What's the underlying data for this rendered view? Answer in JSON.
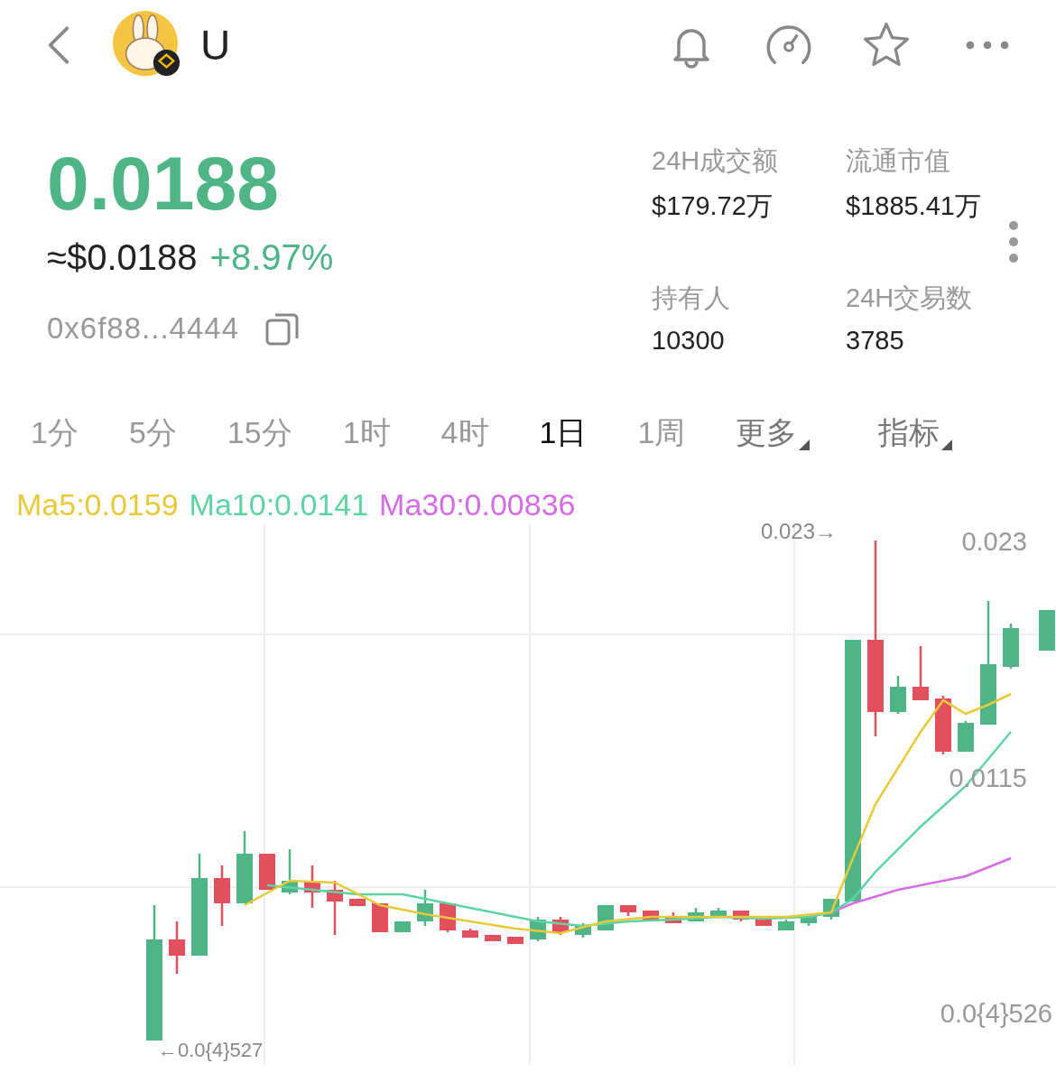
{
  "header": {
    "token_name": "U"
  },
  "price": {
    "value": "0.0188",
    "usd": "≈$0.0188",
    "change": "+8.97%",
    "address": "0x6f88...4444"
  },
  "stats": [
    {
      "label": "24H成交额",
      "value": "$179.72万"
    },
    {
      "label": "流通市值",
      "value": "$1885.41万"
    },
    {
      "label": "持有人",
      "value": "10300"
    },
    {
      "label": "24H交易数",
      "value": "3785"
    }
  ],
  "timeframes": [
    {
      "label": "1分",
      "selected": false,
      "dropdown": false
    },
    {
      "label": "5分",
      "selected": false,
      "dropdown": false
    },
    {
      "label": "15分",
      "selected": false,
      "dropdown": false
    },
    {
      "label": "1时",
      "selected": false,
      "dropdown": false
    },
    {
      "label": "4时",
      "selected": false,
      "dropdown": false
    },
    {
      "label": "1日",
      "selected": true,
      "dropdown": false
    },
    {
      "label": "1周",
      "selected": false,
      "dropdown": false
    },
    {
      "label": "更多",
      "selected": false,
      "dropdown": true
    },
    {
      "label": "指标",
      "selected": false,
      "dropdown": true
    }
  ],
  "moving_averages": [
    {
      "label": "Ma5:0.0159",
      "color": "#e8c93a"
    },
    {
      "label": "Ma10:0.0141",
      "color": "#5fd3a4"
    },
    {
      "label": "Ma30:0.00836",
      "color": "#d36ce6"
    }
  ],
  "chart": {
    "high_marker": "0.023→",
    "axis_labels": [
      "0.023",
      "0.0115",
      "0.0{4}526"
    ],
    "low_marker": "←0.0{4}527"
  }
}
